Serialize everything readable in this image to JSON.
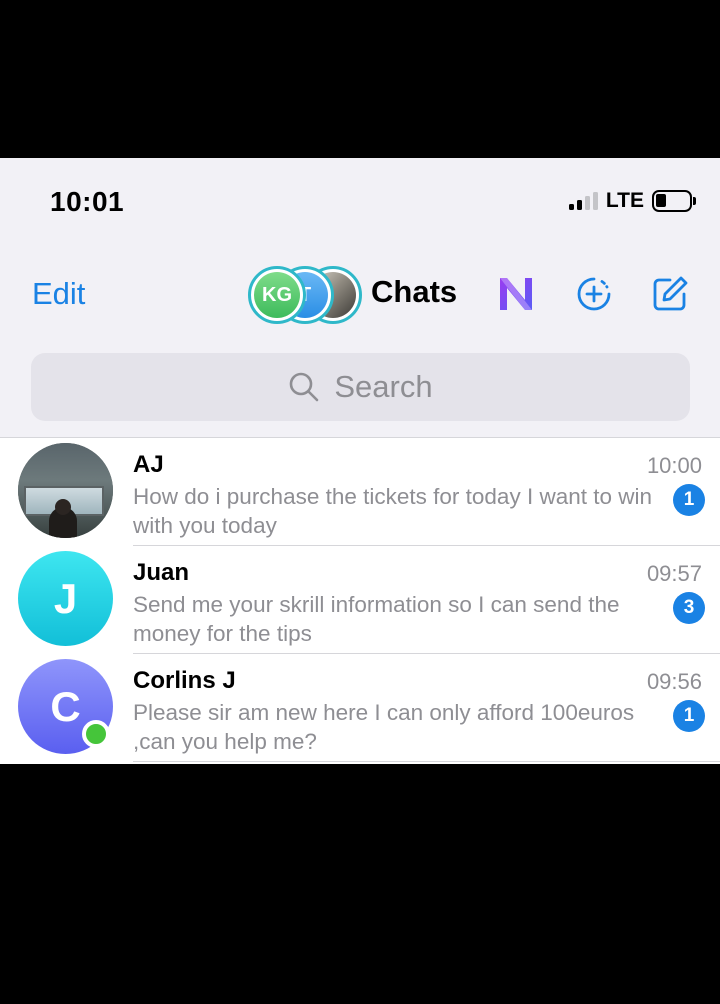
{
  "status_bar": {
    "time": "10:01",
    "network": "LTE"
  },
  "nav": {
    "edit_label": "Edit",
    "title": "Chats",
    "stories": [
      {
        "initials": "KG"
      },
      {
        "initials": "T"
      },
      {
        "initials": ""
      }
    ]
  },
  "search": {
    "placeholder": "Search"
  },
  "chats": [
    {
      "name": "AJ",
      "time": "10:00",
      "message": "How do i purchase the tickets for today I want to win with you today",
      "unread": "1",
      "avatar_initial": ""
    },
    {
      "name": "Juan",
      "time": "09:57",
      "message": "Send me your skrill information so I can send the money for the tips",
      "unread": "3",
      "avatar_initial": "J"
    },
    {
      "name": "Corlins J",
      "time": "09:56",
      "message": "Please sir am new here I can only afford 100euros ,can you help me?",
      "unread": "1",
      "avatar_initial": "C",
      "online": true
    }
  ],
  "colors": {
    "accent": "#1a82e4",
    "online": "#45c53a"
  }
}
